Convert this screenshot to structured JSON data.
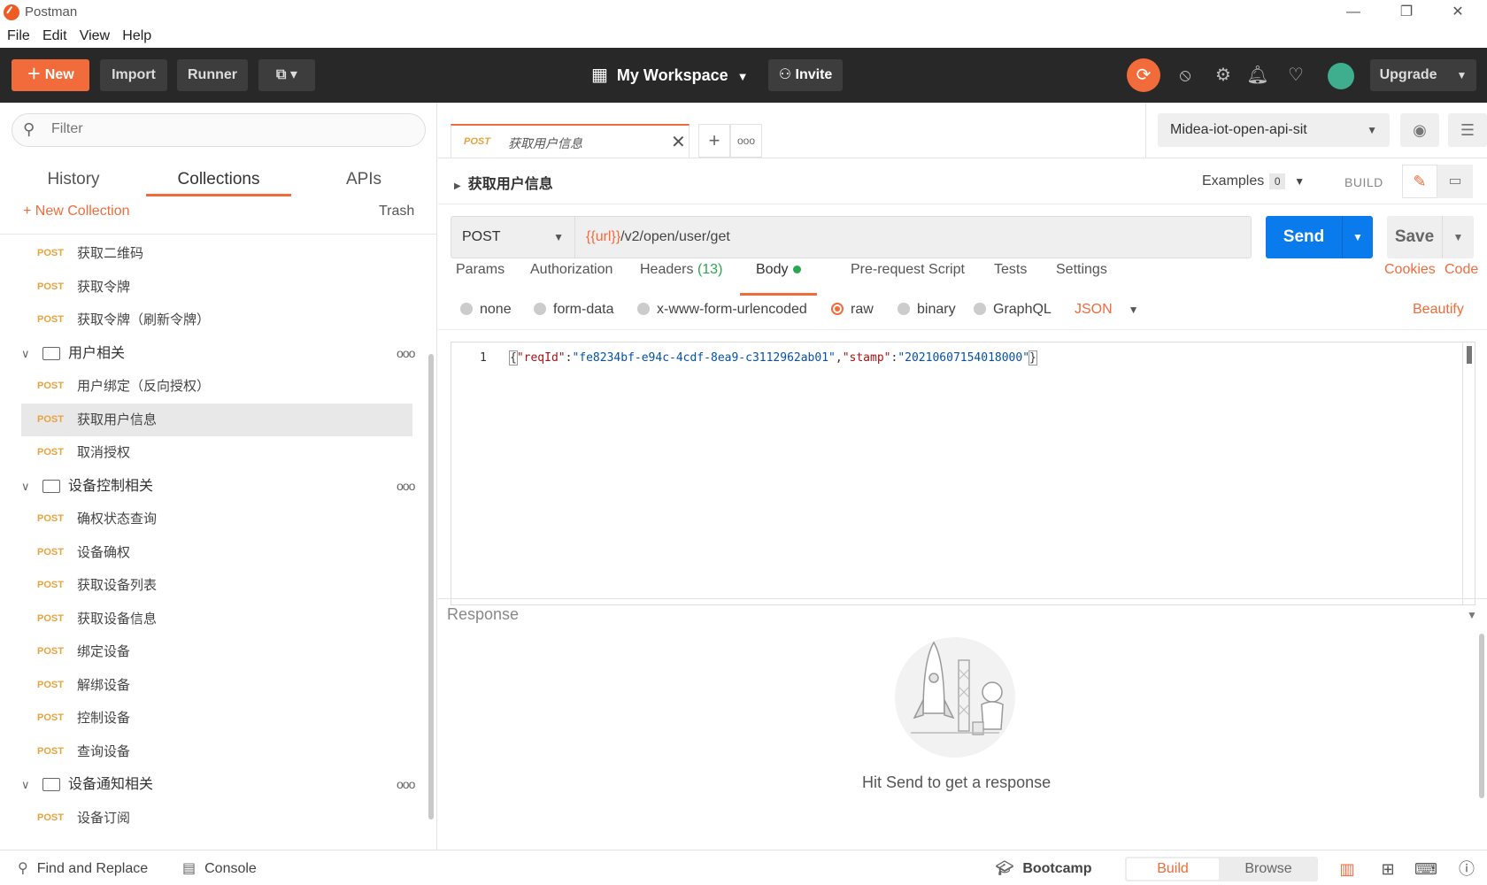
{
  "window": {
    "title": "Postman",
    "controls": [
      "—",
      "❐",
      "✕"
    ]
  },
  "menu": [
    "File",
    "Edit",
    "View",
    "Help"
  ],
  "header": {
    "new_label": "New",
    "import_label": "Import",
    "runner_label": "Runner",
    "workspace_label": "My Workspace",
    "invite_label": "Invite",
    "upgrade_label": "Upgrade"
  },
  "sidebar": {
    "filter_placeholder": "Filter",
    "tabs": [
      "History",
      "Collections",
      "APIs"
    ],
    "new_collection_label": "+ New Collection",
    "trash_label": "Trash",
    "tree": [
      {
        "type": "request",
        "method": "POST",
        "name": "获取二维码"
      },
      {
        "type": "request",
        "method": "POST",
        "name": "获取令牌"
      },
      {
        "type": "request",
        "method": "POST",
        "name": "获取令牌（刷新令牌）"
      },
      {
        "type": "folder",
        "name": "用户相关"
      },
      {
        "type": "request",
        "method": "POST",
        "name": "用户绑定（反向授权）"
      },
      {
        "type": "request",
        "method": "POST",
        "name": "获取用户信息",
        "selected": true
      },
      {
        "type": "request",
        "method": "POST",
        "name": "取消授权"
      },
      {
        "type": "folder",
        "name": "设备控制相关"
      },
      {
        "type": "request",
        "method": "POST",
        "name": "确权状态查询"
      },
      {
        "type": "request",
        "method": "POST",
        "name": "设备确权"
      },
      {
        "type": "request",
        "method": "POST",
        "name": "获取设备列表"
      },
      {
        "type": "request",
        "method": "POST",
        "name": "获取设备信息"
      },
      {
        "type": "request",
        "method": "POST",
        "name": "绑定设备"
      },
      {
        "type": "request",
        "method": "POST",
        "name": "解绑设备"
      },
      {
        "type": "request",
        "method": "POST",
        "name": "控制设备"
      },
      {
        "type": "request",
        "method": "POST",
        "name": "查询设备"
      },
      {
        "type": "folder",
        "name": "设备通知相关"
      },
      {
        "type": "request",
        "method": "POST",
        "name": "设备订阅"
      }
    ]
  },
  "request_tab": {
    "method": "POST",
    "name": "获取用户信息"
  },
  "environment": {
    "selected": "Midea-iot-open-api-sit"
  },
  "request": {
    "title": "获取用户信息",
    "examples_label": "Examples",
    "examples_count": "0",
    "build_label": "BUILD",
    "method": "POST",
    "url_var": "{{url}}",
    "url_path": "/v2/open/user/get",
    "send_label": "Send",
    "save_label": "Save",
    "tabs": {
      "params": "Params",
      "authorization": "Authorization",
      "headers": "Headers",
      "headers_count": "(13)",
      "body": "Body",
      "prerequest": "Pre-request Script",
      "tests": "Tests",
      "settings": "Settings"
    },
    "cookies_label": "Cookies",
    "code_label": "Code",
    "body_modes": [
      "none",
      "form-data",
      "x-www-form-urlencoded",
      "raw",
      "binary",
      "GraphQL"
    ],
    "body_mode_selected": "raw",
    "body_format": "JSON",
    "beautify_label": "Beautify",
    "body_line_number": "1",
    "body": {
      "k1": "\"reqId\"",
      "v1": "\"fe8234bf-e94c-4cdf-8ea9-c3112962ab01\"",
      "k2": "\"stamp\"",
      "v2": "\"20210607154018000\""
    }
  },
  "response": {
    "label": "Response",
    "hint": "Hit Send to get a response"
  },
  "statusbar": {
    "find_replace": "Find and Replace",
    "console": "Console",
    "bootcamp": "Bootcamp",
    "build": "Build",
    "browse": "Browse"
  },
  "colors": {
    "accent": "#f26b3a",
    "send": "#097bed",
    "method_post": "#e8a33c",
    "header_bg": "#282828"
  }
}
